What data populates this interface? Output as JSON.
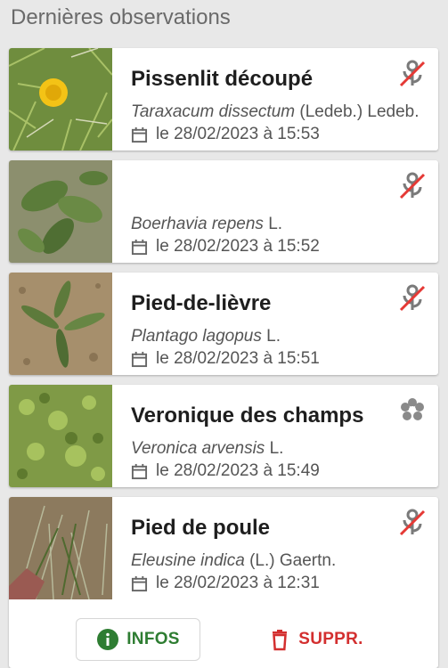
{
  "header": {
    "title": "Dernières observations"
  },
  "observations": [
    {
      "common_name": "Pissenlit découpé",
      "scientific_name": "Taraxacum dissectum",
      "author": " (Ledeb.) Ledeb.",
      "date": "le 28/02/2023 à 15:53",
      "status_icon": "plant-crossed-icon",
      "thumb": "dandelion-photo"
    },
    {
      "common_name": "",
      "scientific_name": "Boerhavia repens",
      "author": " L.",
      "date": "le 28/02/2023 à 15:52",
      "status_icon": "plant-crossed-icon",
      "thumb": "boerhavia-photo"
    },
    {
      "common_name": "Pied-de-lièvre",
      "scientific_name": "Plantago lagopus",
      "author": " L.",
      "date": "le 28/02/2023 à 15:51",
      "status_icon": "plant-crossed-icon",
      "thumb": "plantago-photo"
    },
    {
      "common_name": "Veronique des champs",
      "scientific_name": "Veronica arvensis",
      "author": " L.",
      "date": "le 28/02/2023 à 15:49",
      "status_icon": "flower-gear-icon",
      "thumb": "veronica-photo"
    },
    {
      "common_name": "Pied de poule",
      "scientific_name": "Eleusine indica",
      "author": " (L.) Gaertn.",
      "date": "le 28/02/2023 à 12:31",
      "status_icon": "plant-crossed-icon",
      "thumb": "eleusine-photo"
    }
  ],
  "actions": {
    "info_label": "INFOS",
    "delete_label": "SUPPR."
  },
  "colors": {
    "info_green": "#2e7d32",
    "delete_red": "#d32f2f",
    "crossed_icon": "#7a7a7a",
    "strike_red": "#e53935"
  }
}
